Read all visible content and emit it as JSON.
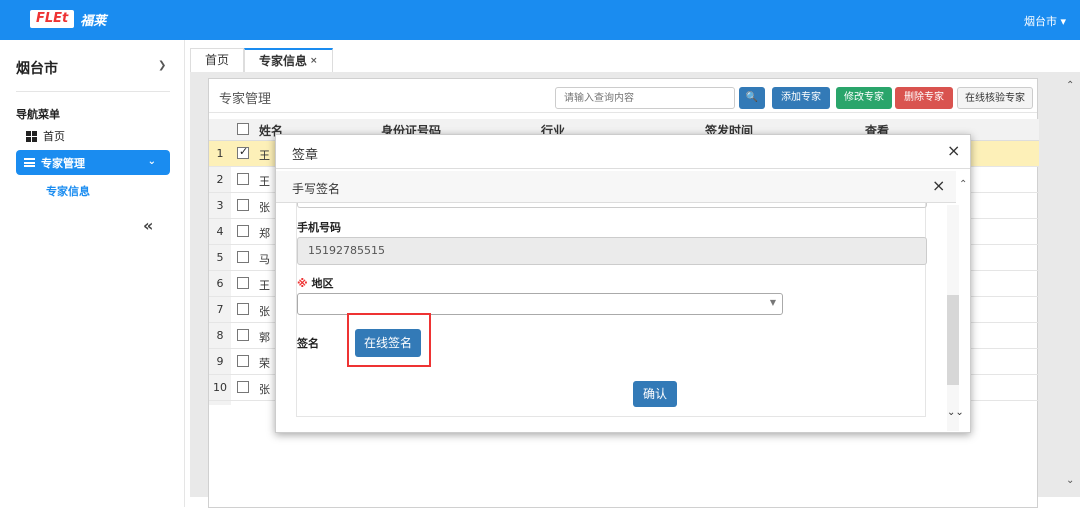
{
  "header": {
    "logo_mark": "FLEt",
    "logo_text": "福莱",
    "city_menu": "烟台市 ▾"
  },
  "sidebar": {
    "city": "烟台市",
    "nav_title": "导航菜单",
    "home": "首页",
    "active": "专家管理",
    "sub": "专家信息",
    "collapse": "«"
  },
  "tabs": [
    {
      "label": "首页"
    },
    {
      "label": "专家信息",
      "close": "×"
    }
  ],
  "panel": {
    "title": "专家管理",
    "search_placeholder": "请输入查询内容",
    "buttons": {
      "add": "添加专家",
      "edit": "修改专家",
      "delete": "删除专家",
      "verify": "在线核验专家"
    },
    "columns": [
      "姓名",
      "身份证号码",
      "行业",
      "签发时间",
      "查看"
    ],
    "rows": [
      {
        "n": "1",
        "name": "王"
      },
      {
        "n": "2",
        "name": "王"
      },
      {
        "n": "3",
        "name": "张"
      },
      {
        "n": "4",
        "name": "郑"
      },
      {
        "n": "5",
        "name": "马"
      },
      {
        "n": "6",
        "name": "王"
      },
      {
        "n": "7",
        "name": "张"
      },
      {
        "n": "8",
        "name": "郭"
      },
      {
        "n": "9",
        "name": "荣"
      },
      {
        "n": "10",
        "name": "张"
      }
    ]
  },
  "modal_outer": {
    "title": "签章",
    "close": "×"
  },
  "modal_inner": {
    "title": "手写签名",
    "close": "×",
    "phone_label": "手机号码",
    "phone_value": "15192785515",
    "region_mark": "※",
    "region_label": "地区",
    "sign_label": "签名",
    "sign_button": "在线签名",
    "confirm_button": "确认"
  }
}
